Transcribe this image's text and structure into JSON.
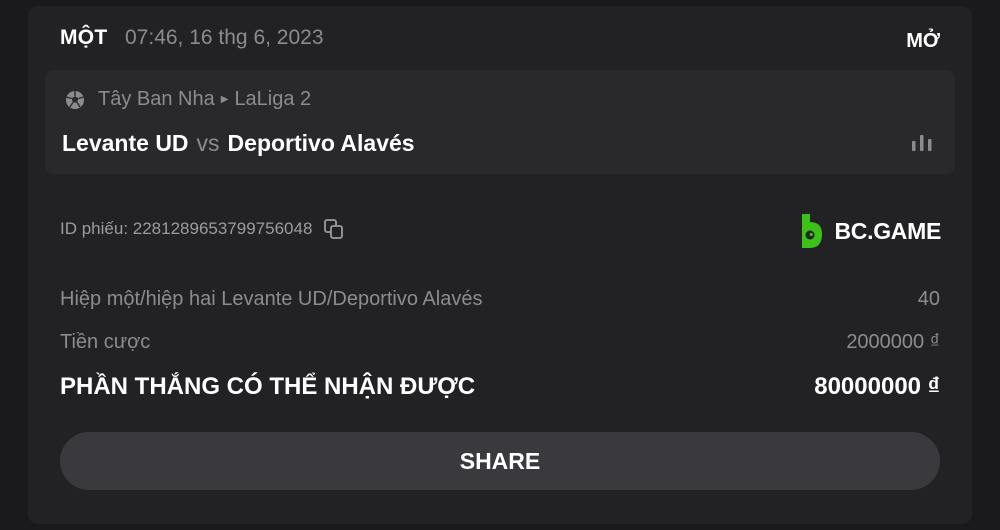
{
  "header": {
    "bet_type": "MỘT",
    "datetime": "07:46, 16 thg 6, 2023",
    "status": "MỞ"
  },
  "match": {
    "sport_icon": "soccer-ball-icon",
    "country": "Tây Ban Nha",
    "league": "LaLiga 2",
    "home_team": "Levante UD",
    "vs": "vs",
    "away_team": "Deportivo Alavés",
    "stats_icon": "bar-chart-icon"
  },
  "ticket": {
    "id_label": "ID phiếu: 2281289653799756048",
    "copy_icon": "copy-icon",
    "brand_name": "BC.GAME",
    "brand_color": "#3bc117"
  },
  "bet": {
    "market": "Hiệp một/hiệp hai Levante UD/Deportivo Alavés",
    "odds": "40",
    "stake_label": "Tiền cược",
    "stake_value": "2000000 ₫",
    "payout_label": "PHẦN THẮNG CÓ THỂ NHẬN ĐƯỢC",
    "payout_value": "80000000 ₫"
  },
  "actions": {
    "share_label": "SHARE"
  }
}
